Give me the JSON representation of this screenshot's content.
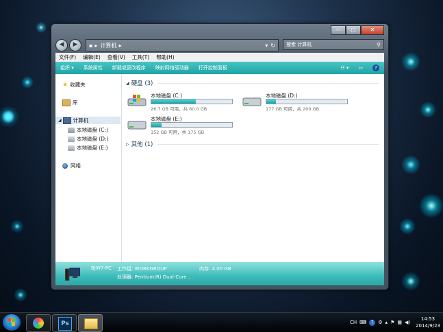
{
  "window": {
    "controls": {
      "minimize": "—",
      "maximize": "▢",
      "close": "✕"
    },
    "address": {
      "segment": "计算机"
    },
    "search": {
      "placeholder": "搜索 计算机"
    }
  },
  "menu": [
    "文件(F)",
    "编辑(E)",
    "查看(V)",
    "工具(T)",
    "帮助(H)"
  ],
  "commands": [
    "组织 ▾",
    "系统属性",
    "卸载或更改程序",
    "映射网络驱动器",
    "打开控制面板"
  ],
  "nav": {
    "favorites": "收藏夹",
    "libraries": "库",
    "computer": "计算机",
    "drives": [
      "本地磁盘 (C:)",
      "本地磁盘 (D:)",
      "本地磁盘 (E:)"
    ],
    "network": "网络"
  },
  "groups": {
    "hard_disks": "硬盘 (3)",
    "other": "其他 (1)"
  },
  "drives": [
    {
      "name": "本地磁盘 (C:)",
      "info": "26.7 GB 可用，共 60.0 GB",
      "used_fraction": 0.555
    },
    {
      "name": "本地磁盘 (D:)",
      "info": "177 GB 可用，共 200 GB",
      "used_fraction": 0.115
    },
    {
      "name": "本地磁盘 (E:)",
      "info": "152 GB 可用，共 175 GB",
      "used_fraction": 0.131
    }
  ],
  "details": {
    "pc_name": "BJW7-PC",
    "workgroup": "工作组: WORKGROUP",
    "memory": "内存: 4.00 GB",
    "processor": "处理器: Pentium(R) Dual-Core ..."
  },
  "taskbar": {
    "ime": "CH",
    "time": "14:53",
    "date": "2014/9/23",
    "ps_label": "Ps"
  },
  "colors": {
    "accent": "#27aeae"
  }
}
